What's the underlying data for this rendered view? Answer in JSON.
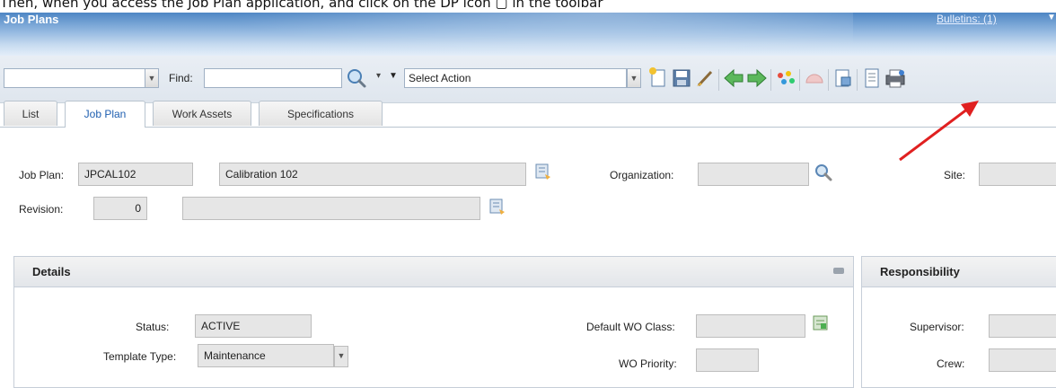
{
  "caption": "Then, when you access the Job Plan application, and click on the DP icon  ▢  in the toolbar",
  "header": {
    "title": "Job Plans",
    "bulletins": "Bulletins: (1)"
  },
  "toolbar": {
    "find_label": "Find:",
    "select_action": "Select Action"
  },
  "tabs": [
    {
      "label": "List",
      "active": false
    },
    {
      "label": "Job Plan",
      "active": true
    },
    {
      "label": "Work Assets",
      "active": false
    },
    {
      "label": "Specifications",
      "active": false
    }
  ],
  "form": {
    "job_plan_label": "Job Plan:",
    "job_plan_value": "JPCAL102",
    "description": "Calibration 102",
    "organization_label": "Organization:",
    "organization_value": "",
    "site_label": "Site:",
    "revision_label": "Revision:",
    "revision_value": "0"
  },
  "details": {
    "title": "Details",
    "status_label": "Status:",
    "status_value": "ACTIVE",
    "template_type_label": "Template Type:",
    "template_type_value": "Maintenance",
    "default_wo_class_label": "Default WO Class:",
    "wo_priority_label": "WO Priority:"
  },
  "responsibility": {
    "title": "Responsibility",
    "supervisor_label": "Supervisor:",
    "crew_label": "Crew:"
  },
  "colors": {
    "accent": "#1f5fb0",
    "annotation_arrow": "#e02020"
  }
}
